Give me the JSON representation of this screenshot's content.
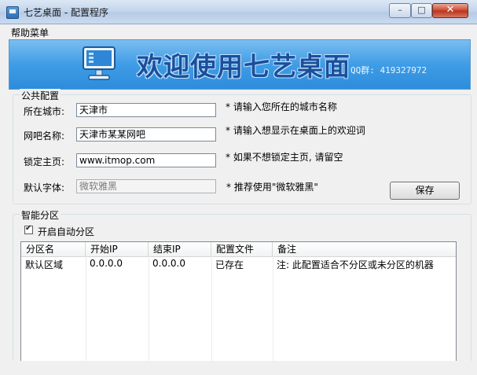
{
  "window": {
    "title": "七艺桌面 - 配置程序",
    "minimize_glyph": "–",
    "maximize_glyph": "□",
    "close_glyph": "✕"
  },
  "menu": {
    "help_label": "帮助菜单"
  },
  "banner": {
    "title": "欢迎使用七艺桌面",
    "qq_text": "QQ群: 419327972"
  },
  "public_config": {
    "legend": "公共配置",
    "city_label": "所在城市:",
    "city_value": "天津市",
    "city_hint": "* 请输入您所在的城市名称",
    "bar_label": "网吧名称:",
    "bar_value": "天津市某某网吧",
    "bar_hint": "* 请输入想显示在桌面上的欢迎词",
    "homepage_label": "锁定主页:",
    "homepage_value": "www.itmop.com",
    "homepage_hint": "* 如果不想锁定主页, 请留空",
    "font_label": "默认字体:",
    "font_value": "微软雅黑",
    "font_hint": "* 推荐使用\"微软雅黑\"",
    "save_label": "保存"
  },
  "smart_partition": {
    "legend": "智能分区",
    "auto_label": "开启自动分区",
    "auto_checked": true,
    "columns": [
      "分区名",
      "开始IP",
      "结束IP",
      "配置文件",
      "备注"
    ],
    "rows": [
      {
        "name": "默认区域",
        "start_ip": "0.0.0.0",
        "end_ip": "0.0.0.0",
        "config": "已存在",
        "note": "注: 此配置适合不分区或未分区的机器"
      }
    ]
  },
  "colors": {
    "banner_top": "#7bbef0",
    "banner_bottom": "#2d8ddb",
    "banner_title": "#1b4f9b",
    "close_button": "#c8462c"
  }
}
